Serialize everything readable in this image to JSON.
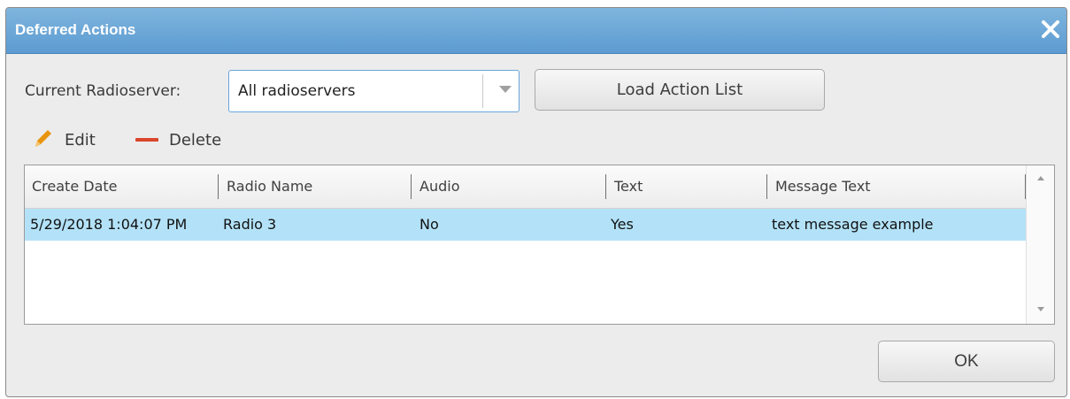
{
  "dialog": {
    "title": "Deferred Actions",
    "close_icon": "close-icon"
  },
  "server": {
    "label": "Current Radioserver:",
    "selected": "All radioservers",
    "load_button": "Load Action List"
  },
  "toolbar": {
    "edit_label": "Edit",
    "edit_icon": "pencil-icon",
    "delete_label": "Delete",
    "delete_icon": "minus-icon"
  },
  "table": {
    "columns": [
      "Create Date",
      "Radio Name",
      "Audio",
      "Text",
      "Message Text"
    ],
    "rows": [
      {
        "create_date": "5/29/2018 1:04:07 PM",
        "radio_name": "Radio 3",
        "audio": "No",
        "text": "Yes",
        "message_text": "text message example",
        "selected": true
      }
    ]
  },
  "footer": {
    "ok_label": "OK"
  },
  "colors": {
    "title_bar": "#5c9bd1",
    "selected_row": "#b3e2f8",
    "delete_icon": "#d9462b",
    "edit_icon": "#e8950e"
  }
}
